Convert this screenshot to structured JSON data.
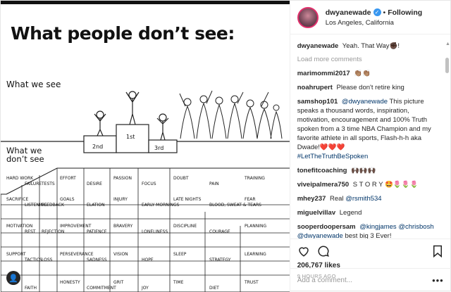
{
  "image": {
    "heading": "What people don’t see:",
    "what_we_see": "What we see",
    "what_we_dont_see_1": "What we",
    "what_we_dont_see_2": "don’t see",
    "podium": [
      "2nd",
      "1st",
      "3rd"
    ],
    "iceberg_words": [
      "EFFORT",
      "DESIRE",
      "PASSION",
      "FOCUS",
      "DOUBT",
      "PAIN",
      "TRAINING",
      "FAILURE",
      "HARD WORK",
      "TESTS",
      "GOALS",
      "ELATION",
      "INJURY",
      "EARLY MORNINGS",
      "LATE NIGHTS",
      "BLOOD, SWEAT & TEARS",
      "FEAR",
      "LISTENING",
      "SACRIFICE",
      "FEEDBACK",
      "IMPROVEMENT",
      "PATIENCE",
      "BRAVERY",
      "LONELINESS",
      "DISCIPLINE",
      "COURAGE",
      "PLANNING",
      "REST",
      "MOTIVATION",
      "REJECTION",
      "PERSEVERANCE",
      "SADNESS",
      "VISION",
      "HOPE",
      "SLEEP",
      "STRATEGY",
      "LEARNING",
      "TACTICS",
      "SUPPORT",
      "LOSS",
      "HONESTY",
      "COMMITMENT",
      "GRIT",
      "JOY",
      "TIME",
      "DIET",
      "TRUST",
      "FAITH"
    ]
  },
  "post": {
    "username": "dwyanewade",
    "verified_mark": "✓",
    "follow_label": "Following",
    "location": "Los Angeles, California",
    "caption_user": "dwyanewade",
    "caption_text": "Yeah. That Way✊🏿!",
    "load_more": "Load more comments",
    "likes": "206,767 likes",
    "time": "9 HOURS AGO",
    "add_comment_placeholder": "Add a comment...",
    "more_label": "•••"
  },
  "comments": [
    {
      "user": "marimommi2017",
      "text": "👏🏽👏🏽"
    },
    {
      "user": "noahrupert",
      "text": "Please don't retire king"
    },
    {
      "user": "samshop101",
      "mention": "@dwyanewade",
      "text": "This picture speaks a thousand words, inspiration, motivation, encouragement and 100% Truth spoken from a 3 time NBA Champion and my favorite athlete in all sports, Flash-h-h aka Dwade!❤️❤️❤️",
      "tag": "#LetTheTruthBeSpoken"
    },
    {
      "user": "tonefitcoaching",
      "text": "🙌🏿🙌🏿🙌🏿"
    },
    {
      "user": "viveipalmera750",
      "text": "S T O R Y 🤩🌷🌷🌷"
    },
    {
      "user": "mhey237",
      "text": "Real",
      "mention": "@rsmith534"
    },
    {
      "user": "miguelvillav",
      "text": "Legend"
    },
    {
      "user": "sooperdoopersam",
      "mention": "@kingjames",
      "mention2": "@chrisbosh",
      "mention3": "@dwyanewade",
      "text": "best big 3 Ever!"
    }
  ],
  "icons": [
    "heart-icon",
    "comment-icon",
    "bookmark-icon",
    "user-tag-icon"
  ]
}
